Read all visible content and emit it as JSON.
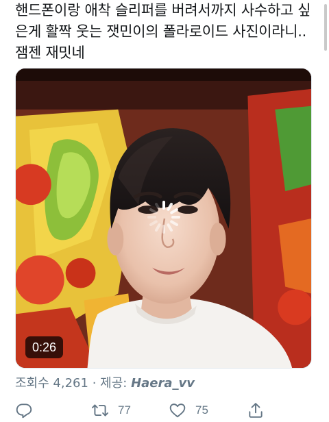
{
  "tweet": {
    "text": "핸드폰이랑 애착 슬리퍼를 버려서까지 사수하고 싶은게 활짝 웃는 잿민이의 폴라로이드 사진이라니.. 잼젠 재밋네"
  },
  "media": {
    "duration": "0:26",
    "loading": true
  },
  "meta": {
    "views_label": "조회수",
    "views_count": "4,261",
    "separator": "·",
    "credit_label": "제공:",
    "credit_user": "Haera_vv"
  },
  "actions": {
    "reply_icon": "reply-icon",
    "retweet_icon": "retweet-icon",
    "retweet_count": "77",
    "like_icon": "like-icon",
    "like_count": "75",
    "share_icon": "share-icon"
  },
  "colors": {
    "text": "#14171a",
    "muted": "#657786"
  }
}
